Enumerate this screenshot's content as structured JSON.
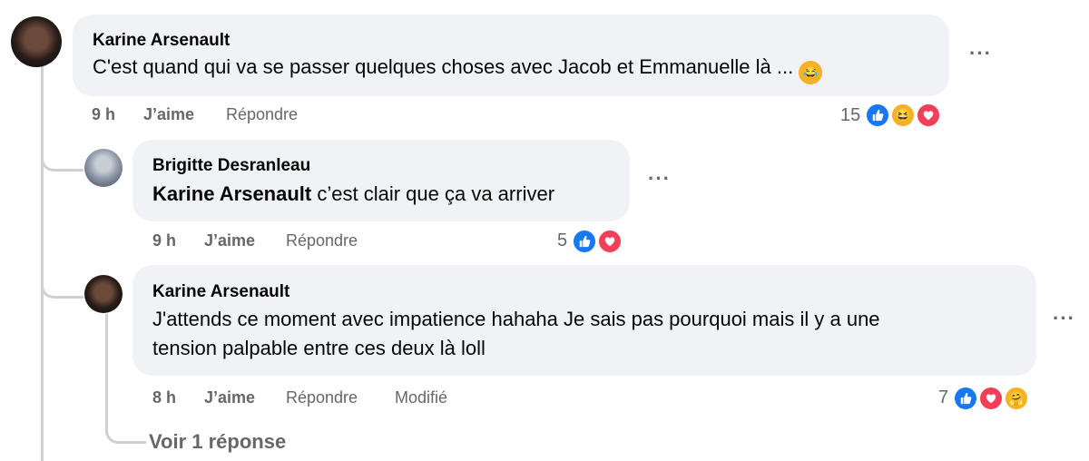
{
  "comments": [
    {
      "author": "Karine Arsenault",
      "text": "C'est quand qui va se passer quelques choses avec Jacob et Emmanuelle là ...",
      "time": "9 h",
      "like_label": "J’aime",
      "reply_label": "Répondre",
      "reaction_count": "15",
      "reactions": [
        "like-icon",
        "haha-icon",
        "love-icon"
      ]
    },
    {
      "author": "Brigitte Desranleau",
      "mention": "Karine Arsenault",
      "text": "c’est clair que ça va arriver",
      "time": "9 h",
      "like_label": "J’aime",
      "reply_label": "Répondre",
      "reaction_count": "5",
      "reactions": [
        "like-icon",
        "love-icon"
      ]
    },
    {
      "author": "Karine Arsenault",
      "text_line1": "J'attends ce moment avec impatience hahaha Je sais pas pourquoi mais il y a une",
      "text_line2": "tension palpable entre ces deux là loll",
      "time": "8 h",
      "like_label": "J’aime",
      "reply_label": "Répondre",
      "edited_label": "Modifié",
      "reaction_count": "7",
      "reactions": [
        "like-icon",
        "love-icon",
        "care-icon"
      ]
    }
  ],
  "more_options": "···",
  "view_replies": "Voir 1 réponse",
  "colors": {
    "like": "#1877f2",
    "love": "#f33e58",
    "haha": "#f7b125",
    "bubble": "#f0f2f5",
    "meta": "#65676b"
  }
}
